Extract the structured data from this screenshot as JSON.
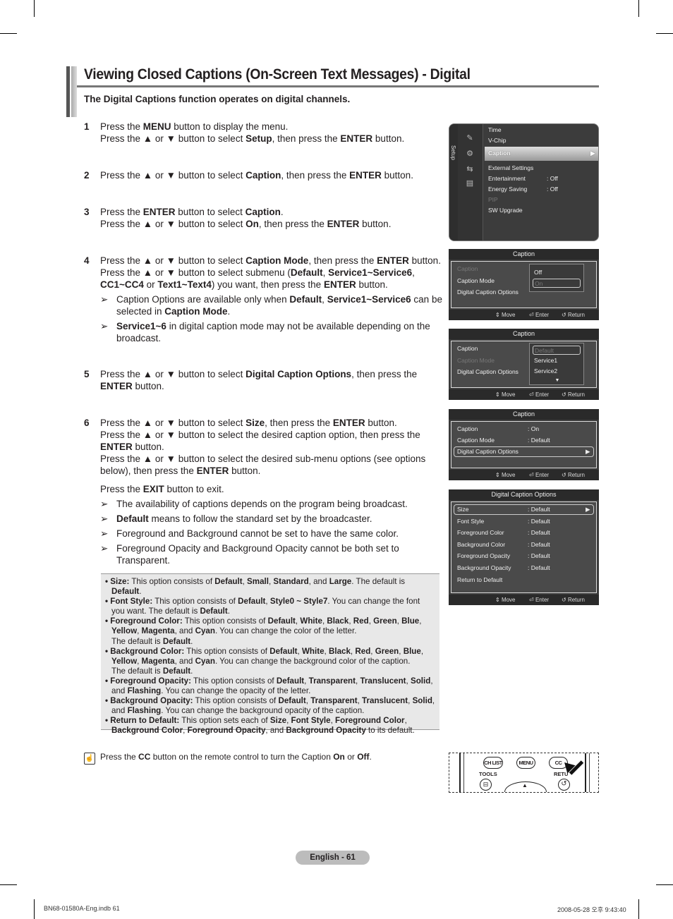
{
  "header": {
    "title": "Viewing Closed Captions (On-Screen Text Messages) - Digital",
    "subtitle": "The Digital Captions function operates on digital channels."
  },
  "steps": [
    {
      "num": "1",
      "lines": [
        [
          [
            "Press the ",
            0
          ],
          [
            "MENU",
            1
          ],
          [
            " button to display the menu.",
            0
          ]
        ],
        [
          [
            "Press the ▲ or ▼ button to select ",
            0
          ],
          [
            "Setup",
            1
          ],
          [
            ", then press the ",
            0
          ],
          [
            "ENTER",
            1
          ],
          [
            " button.",
            0
          ]
        ]
      ]
    },
    {
      "num": "2",
      "lines": [
        [
          [
            "Press the ▲ or ▼ button to select ",
            0
          ],
          [
            "Caption",
            1
          ],
          [
            ", then press the ",
            0
          ],
          [
            "ENTER",
            1
          ],
          [
            " button.",
            0
          ]
        ]
      ]
    },
    {
      "num": "3",
      "lines": [
        [
          [
            "Press the ",
            0
          ],
          [
            "ENTER",
            1
          ],
          [
            " button to select ",
            0
          ],
          [
            "Caption",
            1
          ],
          [
            ".",
            0
          ]
        ],
        [
          [
            "Press the ▲ or ▼ button to select ",
            0
          ],
          [
            "On",
            1
          ],
          [
            ", then press the ",
            0
          ],
          [
            "ENTER",
            1
          ],
          [
            " button.",
            0
          ]
        ]
      ]
    },
    {
      "num": "4",
      "lines": [
        [
          [
            "Press the ▲ or ▼ button to select ",
            0
          ],
          [
            "Caption Mode",
            1
          ],
          [
            ", then press the ",
            0
          ],
          [
            "ENTER",
            1
          ],
          [
            " button.",
            0
          ]
        ],
        [
          [
            "Press the ▲ or ▼ button to select submenu (",
            0
          ],
          [
            "Default",
            1
          ],
          [
            ", ",
            0
          ],
          [
            "Service1~Service6",
            1
          ],
          [
            ", ",
            0
          ],
          [
            "CC1~CC4",
            1
          ],
          [
            " or ",
            0
          ],
          [
            "Text1~Text4",
            1
          ],
          [
            ") you want, then press the ",
            0
          ],
          [
            "ENTER",
            1
          ],
          [
            " button.",
            0
          ]
        ]
      ],
      "notes": [
        [
          [
            "Caption Options are available only when ",
            0
          ],
          [
            "Default",
            1
          ],
          [
            ", ",
            0
          ],
          [
            "Service1~Service6",
            1
          ],
          [
            " can be selected in ",
            0
          ],
          [
            "Caption Mode",
            1
          ],
          [
            ".",
            0
          ]
        ],
        [
          [
            "Service1~6",
            1
          ],
          [
            " in digital caption mode may not be available depending on the broadcast.",
            0
          ]
        ]
      ]
    },
    {
      "num": "5",
      "lines": [
        [
          [
            "Press the ▲ or ▼ button to select ",
            0
          ],
          [
            "Digital Caption Options",
            1
          ],
          [
            ", then press the ",
            0
          ],
          [
            "ENTER",
            1
          ],
          [
            " button.",
            0
          ]
        ]
      ]
    },
    {
      "num": "6",
      "lines": [
        [
          [
            "Press the ▲ or ▼ button to select ",
            0
          ],
          [
            "Size",
            1
          ],
          [
            ", then press the ",
            0
          ],
          [
            "ENTER",
            1
          ],
          [
            " button.",
            0
          ]
        ],
        [
          [
            "Press the ▲ or ▼ button to select the desired caption option, then press the ",
            0
          ],
          [
            "ENTER",
            1
          ],
          [
            " button.",
            0
          ]
        ],
        [
          [
            "Press the ▲ or ▼ button to select the desired sub-menu options (see options below), then press the ",
            0
          ],
          [
            "ENTER",
            1
          ],
          [
            " button.",
            0
          ]
        ]
      ],
      "exit": [
        [
          "Press the ",
          0
        ],
        [
          "EXIT",
          1
        ],
        [
          " button to exit.",
          0
        ]
      ],
      "notes": [
        [
          [
            "The availability of captions depends on the program being broadcast.",
            0
          ]
        ],
        [
          [
            "Default",
            1
          ],
          [
            " means to follow the standard set by the broadcaster.",
            0
          ]
        ],
        [
          [
            "Foreground and Background cannot be set to have the same color.",
            0
          ]
        ],
        [
          [
            "Foreground Opacity and Background Opacity cannot be both set to Transparent.",
            0
          ]
        ]
      ]
    }
  ],
  "options": [
    [
      [
        "Size:",
        1
      ],
      [
        " This option consists of ",
        0
      ],
      [
        "Default",
        1
      ],
      [
        ", ",
        0
      ],
      [
        "Small",
        1
      ],
      [
        ", ",
        0
      ],
      [
        "Standard",
        1
      ],
      [
        ", and ",
        0
      ],
      [
        "Large",
        1
      ],
      [
        ". The default is ",
        0
      ],
      [
        "Default",
        1
      ],
      [
        ".",
        0
      ]
    ],
    [
      [
        "Font Style:",
        1
      ],
      [
        " This option consists of ",
        0
      ],
      [
        "Default",
        1
      ],
      [
        ", ",
        0
      ],
      [
        "Style0 ~ Style7",
        1
      ],
      [
        ". You can change the font you want. The default is ",
        0
      ],
      [
        "Default",
        1
      ],
      [
        ".",
        0
      ]
    ],
    [
      [
        "Foreground Color:",
        1
      ],
      [
        " This option consists of ",
        0
      ],
      [
        "Default",
        1
      ],
      [
        ", ",
        0
      ],
      [
        "White",
        1
      ],
      [
        ", ",
        0
      ],
      [
        "Black",
        1
      ],
      [
        ", ",
        0
      ],
      [
        "Red",
        1
      ],
      [
        ", ",
        0
      ],
      [
        "Green",
        1
      ],
      [
        ", ",
        0
      ],
      [
        "Blue",
        1
      ],
      [
        ", ",
        0
      ],
      [
        "Yellow",
        1
      ],
      [
        ", ",
        0
      ],
      [
        "Magenta",
        1
      ],
      [
        ", and ",
        0
      ],
      [
        "Cyan",
        1
      ],
      [
        ". You can change the color of the letter.",
        0
      ],
      [
        "\nThe default is ",
        0
      ],
      [
        "Default",
        1
      ],
      [
        ".",
        0
      ]
    ],
    [
      [
        "Background Color:",
        1
      ],
      [
        " This option consists of ",
        0
      ],
      [
        "Default",
        1
      ],
      [
        ", ",
        0
      ],
      [
        "White",
        1
      ],
      [
        ", ",
        0
      ],
      [
        "Black",
        1
      ],
      [
        ", ",
        0
      ],
      [
        "Red",
        1
      ],
      [
        ", ",
        0
      ],
      [
        "Green",
        1
      ],
      [
        ", ",
        0
      ],
      [
        "Blue",
        1
      ],
      [
        ", ",
        0
      ],
      [
        "Yellow",
        1
      ],
      [
        ", ",
        0
      ],
      [
        "Magenta",
        1
      ],
      [
        ", and ",
        0
      ],
      [
        "Cyan",
        1
      ],
      [
        ". You can change the background color of the caption.",
        0
      ],
      [
        "\nThe default is ",
        0
      ],
      [
        "Default",
        1
      ],
      [
        ".",
        0
      ]
    ],
    [
      [
        "Foreground Opacity:",
        1
      ],
      [
        " This option consists of ",
        0
      ],
      [
        "Default",
        1
      ],
      [
        ", ",
        0
      ],
      [
        "Transparent",
        1
      ],
      [
        ", ",
        0
      ],
      [
        "Translucent",
        1
      ],
      [
        ", ",
        0
      ],
      [
        "Solid",
        1
      ],
      [
        ", and ",
        0
      ],
      [
        "Flashing",
        1
      ],
      [
        ". You can change the opacity of the letter.",
        0
      ]
    ],
    [
      [
        "Background Opacity:",
        1
      ],
      [
        " This option consists of ",
        0
      ],
      [
        "Default",
        1
      ],
      [
        ", ",
        0
      ],
      [
        "Transparent",
        1
      ],
      [
        ", ",
        0
      ],
      [
        "Translucent",
        1
      ],
      [
        ", ",
        0
      ],
      [
        "Solid",
        1
      ],
      [
        ", and ",
        0
      ],
      [
        "Flashing",
        1
      ],
      [
        ". You can change the background opacity of the caption.",
        0
      ]
    ],
    [
      [
        "Return to Default:",
        1
      ],
      [
        " This option sets each of ",
        0
      ],
      [
        "Size",
        1
      ],
      [
        ", ",
        0
      ],
      [
        "Font Style",
        1
      ],
      [
        ", ",
        0
      ],
      [
        "Foreground Color",
        1
      ],
      [
        ", ",
        0
      ],
      [
        "Background Color",
        1
      ],
      [
        ", ",
        0
      ],
      [
        "Foreground Opacity",
        1
      ],
      [
        ", and ",
        0
      ],
      [
        "Background Opacity",
        1
      ],
      [
        " to its default.",
        0
      ]
    ]
  ],
  "tip": [
    [
      "Press the ",
      0
    ],
    [
      "CC",
      1
    ],
    [
      " button on the remote control to turn the Caption ",
      0
    ],
    [
      "On",
      1
    ],
    [
      " or ",
      0
    ],
    [
      "Off",
      1
    ],
    [
      ".",
      0
    ]
  ],
  "osd_setup": {
    "side_label": "Setup",
    "items": [
      {
        "label": "Time",
        "value": ""
      },
      {
        "label": "V-Chip",
        "value": ""
      },
      {
        "label": "Caption",
        "value": "",
        "selected": true
      },
      {
        "label": "External Settings",
        "value": ""
      },
      {
        "label": "Entertainment",
        "value": ": Off"
      },
      {
        "label": "Energy Saving",
        "value": ": Off"
      },
      {
        "label": "PIP",
        "value": "",
        "disabled": true
      },
      {
        "label": "SW Upgrade",
        "value": ""
      }
    ]
  },
  "osd_caption_1": {
    "title": "Caption",
    "rows": [
      "Caption",
      "Caption Mode",
      "Digital Caption Options"
    ],
    "popup": [
      "Off",
      "On"
    ]
  },
  "osd_caption_2": {
    "title": "Caption",
    "rows": [
      "Caption",
      "Caption Mode",
      "Digital Caption Options"
    ],
    "popup": [
      "Default",
      "Service1",
      "Service2"
    ]
  },
  "osd_caption_3": {
    "title": "Caption",
    "rows": [
      {
        "label": "Caption",
        "value": ": On"
      },
      {
        "label": "Caption Mode",
        "value": ": Default"
      },
      {
        "label": "Digital Caption Options",
        "value": ""
      }
    ]
  },
  "osd_dco": {
    "title": "Digital Caption Options",
    "rows": [
      {
        "label": "Size",
        "value": ": Default"
      },
      {
        "label": "Font Style",
        "value": ": Default"
      },
      {
        "label": "Foreground Color",
        "value": ": Default"
      },
      {
        "label": "Background Color",
        "value": ": Default"
      },
      {
        "label": "Foreground Opacity",
        "value": ": Default"
      },
      {
        "label": "Background Opacity",
        "value": ": Default"
      },
      {
        "label": "Return to Default",
        "value": ""
      }
    ]
  },
  "osd_footer": {
    "move": "Move",
    "enter": "Enter",
    "return": "Return"
  },
  "remote": {
    "ch_list": "CH LIST",
    "menu": "MENU",
    "cc": "CC",
    "tools": "TOOLS",
    "return": "RETU"
  },
  "footer": {
    "page": "English - 61",
    "file": "BN68-01580A-Eng.indb   61",
    "timestamp": "2008-05-28   오후 9:43:40"
  }
}
